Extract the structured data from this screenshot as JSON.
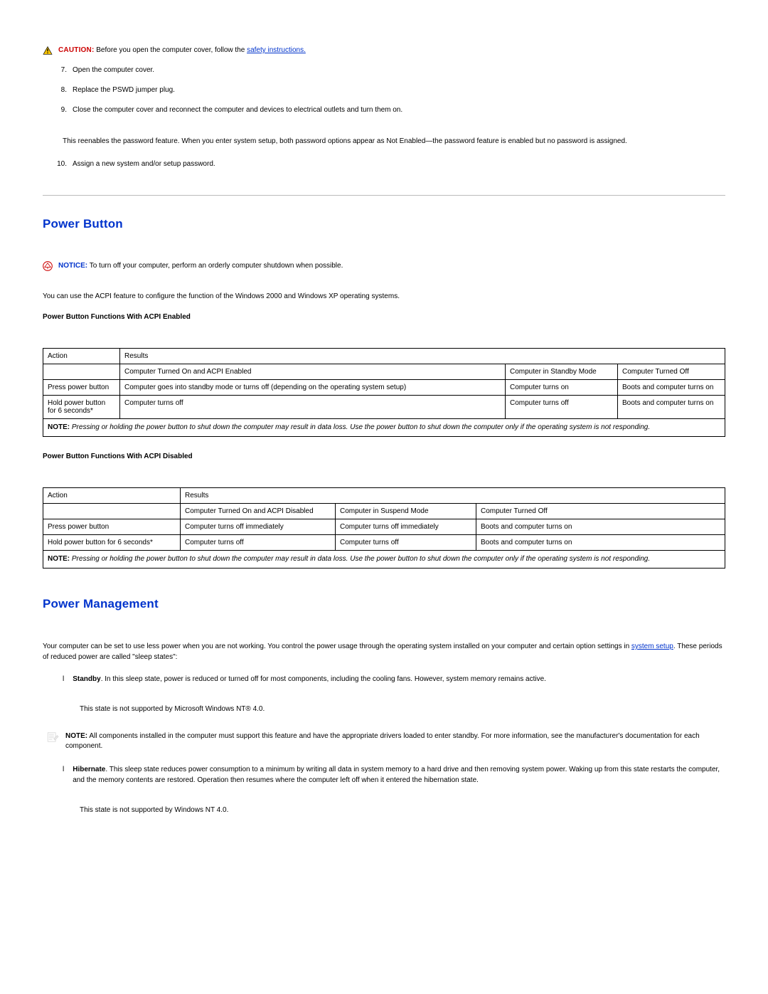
{
  "caution_label": "CAUTION:",
  "caution_text": " Before you open the computer cover, follow the ",
  "caution_link": "safety instructions.",
  "steps": {
    "s7_num": "7.",
    "s7": "Open the computer cover.",
    "s8_num": "8.",
    "s8": "Replace the PSWD jumper plug.",
    "s9_num": "9.",
    "s9": "Close the computer cover and reconnect the computer and devices to electrical outlets and turn them on.",
    "s9_follow": "This reenables the password feature. When you enter system setup, both password options appear as Not Enabled—the password feature is enabled but no password is assigned.",
    "s10_num": "10.",
    "s10": "Assign a new system and/or setup password."
  },
  "power_button_heading": "Power Button",
  "notice_label": "NOTICE:",
  "notice_text": " To turn off your computer, perform an orderly computer shutdown when possible.",
  "acpi_intro": "You can use the ACPI feature to configure the function of the Windows 2000 and Windows XP operating systems.",
  "table1_caption": "Power Button Functions With ACPI Enabled",
  "table1": {
    "hdr_action": "Action",
    "hdr_results": "Results",
    "sub_on": "Computer Turned On and ACPI Enabled",
    "sub_standby": "Computer in Standby Mode",
    "sub_off": "Computer Turned Off",
    "r1_action": "Press power button",
    "r1_c2": "Computer goes into standby mode or turns off (depending on the operating system setup)",
    "r1_c3": "Computer turns on",
    "r1_c4": "Boots and computer turns on",
    "r2_action": "Hold power button for 6 seconds*",
    "r2_c2": "Computer turns off",
    "r2_c3": "Computer turns off",
    "r2_c4": "Boots and computer turns on",
    "note_label": "NOTE:",
    "note_text": " Pressing or holding the power button to shut down the computer may result in data loss. Use the power button to shut down the computer only if the operating system is not responding."
  },
  "table2_caption": "Power Button Functions With ACPI Disabled",
  "table2": {
    "hdr_action": "Action",
    "hdr_results": "Results",
    "sub_on": "Computer Turned On and ACPI Disabled",
    "sub_standby": "Computer in Suspend Mode",
    "sub_off": "Computer Turned Off",
    "r1_action": "Press power button",
    "r1_c2": "Computer turns off immediately",
    "r1_c3": "Computer turns off immediately",
    "r1_c4": "Boots and computer turns on",
    "r2_action": "Hold power button for 6 seconds*",
    "r2_c2": "Computer turns off",
    "r2_c3": "Computer turns off",
    "r2_c4": "Boots and computer turns on",
    "note_label": "NOTE:",
    "note_text": " Pressing or holding the power button to shut down the computer may result in data loss. Use the power button to shut down the computer only if the operating system is not responding."
  },
  "power_mgmt_heading": "Power Management",
  "pm_intro_a": "Your computer can be set to use less power when you are not working. You control the power usage through the operating system installed on your computer and certain option settings in ",
  "pm_intro_link": "system setup",
  "pm_intro_b": ". These periods of reduced power are called \"sleep states\":",
  "standby_name": "Standby",
  "standby_text": ". In this sleep state, power is reduced or turned off for most components, including the cooling fans. However, system memory remains active.",
  "standby_nt": "This state is not supported by Microsoft Windows NT® 4.0.",
  "pm_note_label": "NOTE:",
  "pm_note_text": " All components installed in the computer must support this feature and have the appropriate drivers loaded to enter standby. For more information, see the manufacturer's documentation for each component.",
  "hibernate_name": "Hibernate",
  "hibernate_text": ". This sleep state reduces power consumption to a minimum by writing all data in system memory to a hard drive and then removing system power. Waking up from this state restarts the computer, and the memory contents are restored. Operation then resumes where the computer left off when it entered the hibernation state.",
  "hibernate_nt": "This state is not supported by Windows NT 4.0.",
  "bullet": "l"
}
